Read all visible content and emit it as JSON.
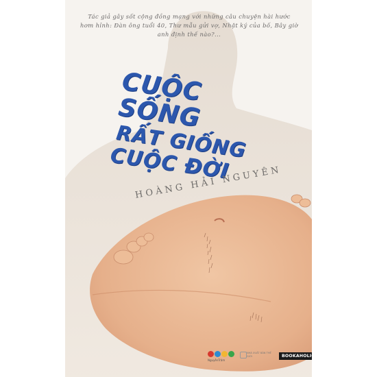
{
  "cover": {
    "blurb": "Tác giả gây sốt cộng đồng mạng với những câu chuyện hài hước hơm hỉnh: Đàn ông tuổi 40, Thư mẫu gửi vợ, Nhật ký của bố, Bây giờ anh định thế nào?...",
    "title_lines": [
      "CUỘC",
      "SỐNG",
      "RẤT GIỐNG",
      "CUỘC ĐỜI"
    ],
    "author": "HOÀNG HẢI NGUYÊN",
    "publisher_logo_caption": "NguyễnTrâm",
    "publisher_text": "NHÀ XUẤT BẢN THẾ GIỚI",
    "brand_label": "BOOKAHOLIC.VN",
    "colors": {
      "title": "#2c57ad",
      "background": "#f6f3ef",
      "silhouette": "#e8dfd5",
      "skin": "#e8b68f"
    }
  }
}
